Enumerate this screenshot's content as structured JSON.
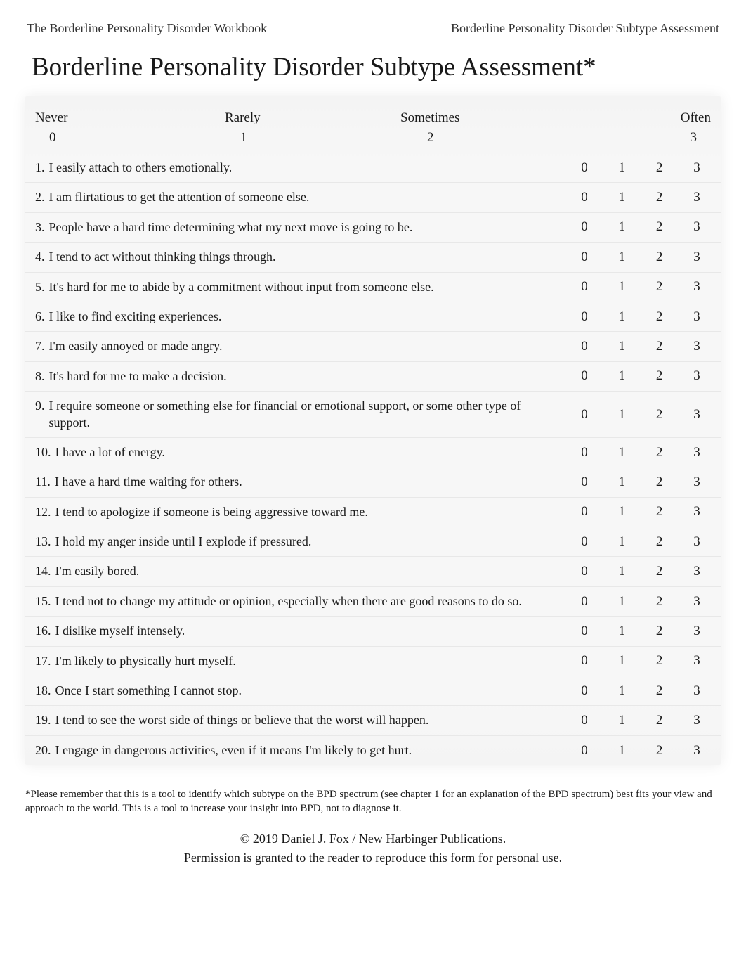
{
  "header": {
    "left": "The Borderline Personality Disorder Workbook",
    "right": "Borderline Personality Disorder Subtype Assessment"
  },
  "title": "Borderline Personality Disorder Subtype Assessment*",
  "scale": {
    "labels": {
      "never": "Never",
      "rarely": "Rarely",
      "sometimes": "Sometimes",
      "often": "Often"
    },
    "values": {
      "v0": "0",
      "v1": "1",
      "v2": "2",
      "v3": "3"
    }
  },
  "options": [
    "0",
    "1",
    "2",
    "3"
  ],
  "questions": [
    {
      "num": "1.",
      "text": "I easily attach to others emotionally."
    },
    {
      "num": "2.",
      "text": "I am flirtatious to get the attention of someone else."
    },
    {
      "num": "3.",
      "text": "People have a hard time determining what my next move is going to be."
    },
    {
      "num": "4.",
      "text": "I tend to act without thinking things through."
    },
    {
      "num": "5.",
      "text": "It's hard for me to abide by a commitment without input from someone else."
    },
    {
      "num": "6.",
      "text": "I like to find exciting experiences."
    },
    {
      "num": "7.",
      "text": "I'm easily annoyed or made angry."
    },
    {
      "num": "8.",
      "text": "It's hard for me to make a decision."
    },
    {
      "num": "9.",
      "text": "I require someone or something else for financial or emotional support, or some other type of support."
    },
    {
      "num": "10.",
      "text": "I have a lot of energy."
    },
    {
      "num": "11.",
      "text": "I have a hard time waiting for others."
    },
    {
      "num": "12.",
      "text": "I tend to apologize if someone is being aggressive toward me."
    },
    {
      "num": "13.",
      "text": "I hold my anger inside until I explode if pressured."
    },
    {
      "num": "14.",
      "text": "I'm easily bored."
    },
    {
      "num": "15.",
      "text": "I tend not to change my attitude or opinion, especially when there are good reasons to do so."
    },
    {
      "num": "16.",
      "text": "I dislike myself intensely."
    },
    {
      "num": "17.",
      "text": "I'm likely to physically hurt myself."
    },
    {
      "num": "18.",
      "text": "Once I start something I cannot stop."
    },
    {
      "num": "19.",
      "text": "I tend to see the worst side of things or believe that the worst will happen."
    },
    {
      "num": "20.",
      "text": "I engage in dangerous activities, even if it means I'm likely to get hurt."
    }
  ],
  "footnote": "*Please remember that this is a tool to identify which subtype on the BPD spectrum (see chapter 1 for an explanation of the BPD spectrum) best fits your view and approach to the world. This is a tool to increase your insight into BPD, not to diagnose it.",
  "copyright": "© 2019 Daniel J. Fox / New Harbinger Publications.",
  "permission": "Permission is granted to the reader to reproduce this form for personal use."
}
